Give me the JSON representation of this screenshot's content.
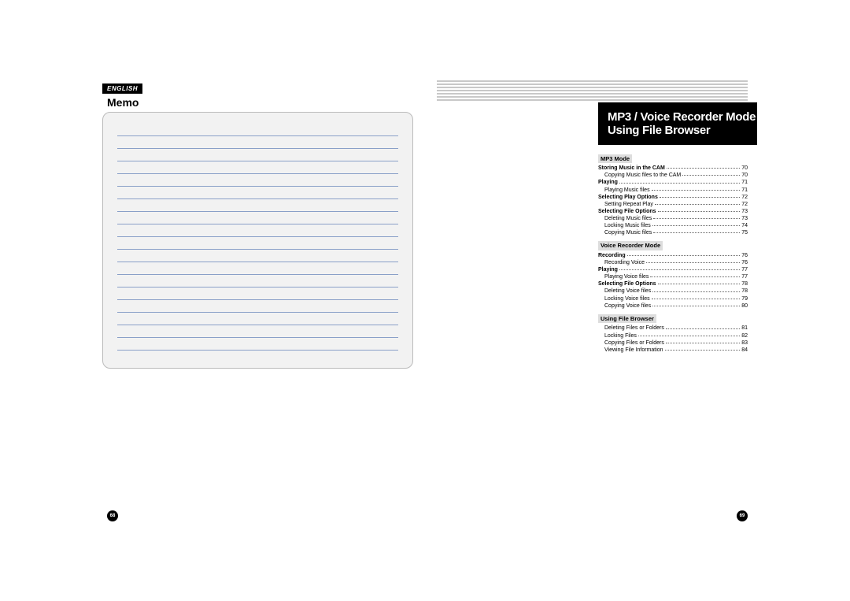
{
  "left": {
    "language": "ENGLISH",
    "memo_title": "Memo",
    "page_number": "68",
    "memo_line_count": 18
  },
  "right": {
    "title_line1": "MP3 / Voice Recorder Mode /",
    "title_line2": "Using File Browser",
    "page_number": "69",
    "sections": [
      {
        "heading": "MP3 Mode",
        "items": [
          {
            "label": "Storing Music in the CAM",
            "page": "70",
            "bold": true,
            "indent": false
          },
          {
            "label": "Copying Music files to the CAM",
            "page": "70",
            "bold": false,
            "indent": true
          },
          {
            "label": "Playing",
            "page": "71",
            "bold": true,
            "indent": false
          },
          {
            "label": "Playing Music files",
            "page": "71",
            "bold": false,
            "indent": true
          },
          {
            "label": "Selecting Play Options",
            "page": "72",
            "bold": true,
            "indent": false
          },
          {
            "label": "Setting Repeat Play",
            "page": "72",
            "bold": false,
            "indent": true
          },
          {
            "label": "Selecting File Options",
            "page": "73",
            "bold": true,
            "indent": false
          },
          {
            "label": "Deleting Music files",
            "page": "73",
            "bold": false,
            "indent": true
          },
          {
            "label": "Locking Music files",
            "page": "74",
            "bold": false,
            "indent": true
          },
          {
            "label": "Copying Music files",
            "page": "75",
            "bold": false,
            "indent": true
          }
        ]
      },
      {
        "heading": "Voice Recorder Mode",
        "items": [
          {
            "label": "Recording",
            "page": "76",
            "bold": true,
            "indent": false
          },
          {
            "label": "Recording Voice",
            "page": "76",
            "bold": false,
            "indent": true
          },
          {
            "label": "Playing",
            "page": "77",
            "bold": true,
            "indent": false
          },
          {
            "label": "Playing Voice files",
            "page": "77",
            "bold": false,
            "indent": true
          },
          {
            "label": "Selecting File Options",
            "page": "78",
            "bold": true,
            "indent": false
          },
          {
            "label": "Deleting Voice files",
            "page": "78",
            "bold": false,
            "indent": true
          },
          {
            "label": "Locking Voice files",
            "page": "79",
            "bold": false,
            "indent": true
          },
          {
            "label": "Copying Voice files",
            "page": "80",
            "bold": false,
            "indent": true
          }
        ]
      },
      {
        "heading": "Using File Browser",
        "items": [
          {
            "label": "Deleting Files or Folders",
            "page": "81",
            "bold": false,
            "indent": true
          },
          {
            "label": "Locking Files",
            "page": "82",
            "bold": false,
            "indent": true
          },
          {
            "label": "Copying Files or Folders",
            "page": "83",
            "bold": false,
            "indent": true
          },
          {
            "label": "Viewing File Information",
            "page": "84",
            "bold": false,
            "indent": true
          }
        ]
      }
    ]
  }
}
